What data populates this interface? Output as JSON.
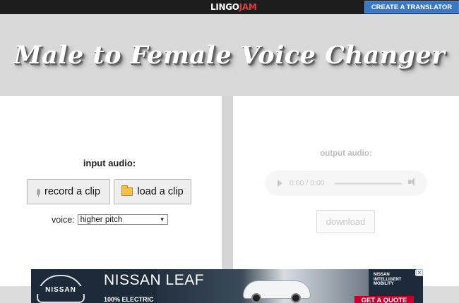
{
  "header": {
    "logo_main": "LINGO",
    "logo_accent": "JAM",
    "cta_label": "CREATE A TRANSLATOR"
  },
  "hero": {
    "title": "Male to Female Voice Changer"
  },
  "input_panel": {
    "label": "input audio:",
    "record_button": "record a clip",
    "load_button": "load a clip",
    "voice_label": "voice:",
    "voice_selected": "higher pitch"
  },
  "output_panel": {
    "label": "output audio:",
    "time_display": "0:00 / 0:00",
    "download_button": "download"
  },
  "ad": {
    "brand": "NISSAN",
    "headline": "NISSAN LEAF",
    "subline": "100% ELECTRIC",
    "tagline_1": "NISSAN",
    "tagline_2": "INTELLIGENT",
    "tagline_3": "MOBILITY",
    "cta": "GET A QUOTE",
    "info_icon": "i",
    "close_icon": "✕"
  },
  "colors": {
    "topbar": "#1d1d1d",
    "logo_accent": "#e23b3b",
    "cta_blue": "#3a78c4",
    "hero_bg": "#d9d9d9",
    "ad_cta_red": "#c3002f"
  }
}
